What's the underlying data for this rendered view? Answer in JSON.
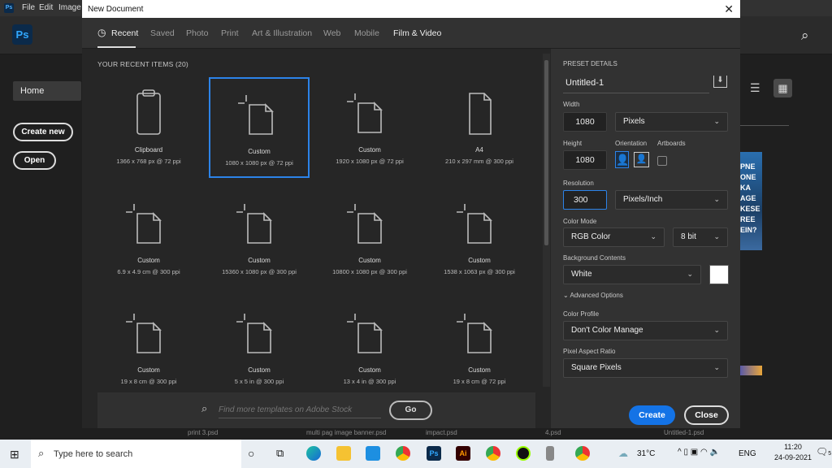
{
  "menubar": {
    "logo": "Ps",
    "items": [
      "File",
      "Edit",
      "Image"
    ]
  },
  "app": {
    "logo": "Ps",
    "home": "Home",
    "create_new": "Create new",
    "open": "Open",
    "poster_text": [
      "PNE",
      "ONE",
      "KA",
      "AGE",
      "KESE",
      "REE",
      "EIN?"
    ]
  },
  "dialog": {
    "title": "New Document",
    "close_glyph": "✕",
    "tabs": [
      "Recent",
      "Saved",
      "Photo",
      "Print",
      "Art & Illustration",
      "Web",
      "Mobile",
      "Film & Video"
    ],
    "recent_heading": "YOUR RECENT ITEMS  (20)",
    "items": [
      {
        "name": "Clipboard",
        "size": "1366 x 768 px @ 72 ppi",
        "icon": "clipboard"
      },
      {
        "name": "Custom",
        "size": "1080 x 1080 px @ 72 ppi",
        "icon": "custom",
        "selected": true
      },
      {
        "name": "Custom",
        "size": "1920 x 1080 px @ 72 ppi",
        "icon": "custom"
      },
      {
        "name": "A4",
        "size": "210 x 297 mm @ 300 ppi",
        "icon": "page"
      },
      {
        "name": "Custom",
        "size": "6.9 x 4.9 cm @ 300 ppi",
        "icon": "custom"
      },
      {
        "name": "Custom",
        "size": "15360 x 1080 px @ 300 ppi",
        "icon": "custom"
      },
      {
        "name": "Custom",
        "size": "10800 x 1080 px @ 300 ppi",
        "icon": "custom"
      },
      {
        "name": "Custom",
        "size": "1538 x 1063 px @ 300 ppi",
        "icon": "custom"
      },
      {
        "name": "Custom",
        "size": "19 x 8 cm @ 300 ppi",
        "icon": "custom"
      },
      {
        "name": "Custom",
        "size": "5 x 5 in @ 300 ppi",
        "icon": "custom"
      },
      {
        "name": "Custom",
        "size": "13 x 4 in @ 300 ppi",
        "icon": "custom"
      },
      {
        "name": "Custom",
        "size": "19 x 8 cm @ 72 ppi",
        "icon": "custom"
      }
    ],
    "search_placeholder": "Find more templates on Adobe Stock",
    "go": "Go"
  },
  "preset": {
    "heading": "PRESET DETAILS",
    "name": "Untitled-1",
    "width_label": "Width",
    "width": "1080",
    "width_unit": "Pixels",
    "height_label": "Height",
    "height": "1080",
    "orientation_label": "Orientation",
    "artboards_label": "Artboards",
    "resolution_label": "Resolution",
    "resolution": "300",
    "resolution_unit": "Pixels/Inch",
    "color_mode_label": "Color Mode",
    "color_mode": "RGB Color",
    "bit_depth": "8 bit",
    "bg_label": "Background Contents",
    "bg": "White",
    "bg_color": "#ffffff",
    "advanced": "Advanced Options",
    "profile_label": "Color Profile",
    "profile": "Don't Color Manage",
    "par_label": "Pixel Aspect Ratio",
    "par": "Square Pixels",
    "create": "Create",
    "close": "Close"
  },
  "behind_files": [
    "print 3.psd",
    "multi pag image banner.psd",
    "impact.psd",
    "4.psd",
    "Untitled-1.psd"
  ],
  "taskbar": {
    "search": "Type here to search",
    "weather": "31°C",
    "lang": "ENG",
    "time": "11:20",
    "date": "24-09-2021",
    "notifications": "5"
  },
  "colors": {
    "accent": "#1473e6",
    "selection": "#2c83e8"
  }
}
